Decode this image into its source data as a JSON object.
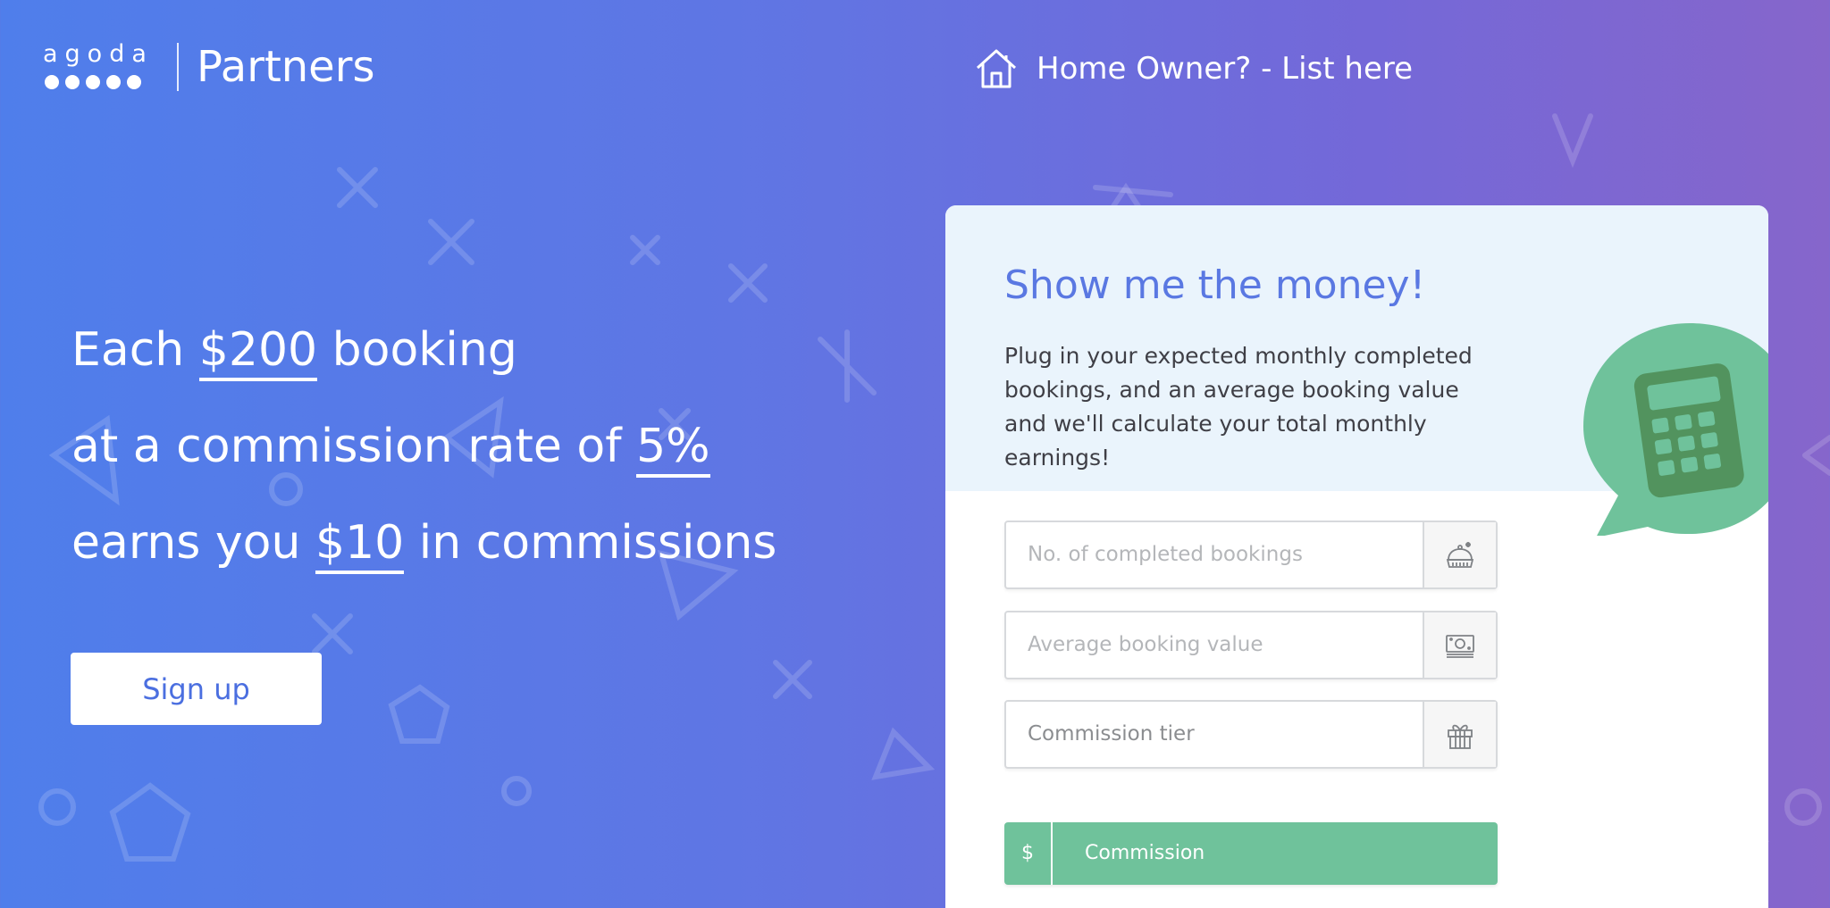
{
  "header": {
    "logo_word": "agoda",
    "logo_partners": "Partners",
    "home_link": "Home Owner? - List here"
  },
  "pitch": {
    "line1_pre": "Each ",
    "line1_value": "$200",
    "line1_post": " booking",
    "line2_pre": "at a commission rate of ",
    "line2_value": "5%",
    "line3_pre": "earns you ",
    "line3_value": "$10",
    "line3_post": " in commissions"
  },
  "signup_label": "Sign up",
  "calculator": {
    "title": "Show me the money!",
    "description": "Plug in your expected monthly completed bookings, and an average booking value and we'll calculate your total monthly earnings!",
    "bookings_placeholder": "No. of completed bookings",
    "booking_value_placeholder": "Average booking value",
    "commission_tier_placeholder": "Commission tier",
    "result_symbol": "$",
    "result_label": "Commission"
  },
  "icons": {
    "home": "home-icon",
    "bookings": "bell-icon",
    "value": "money-icon",
    "tier": "gift-icon",
    "calculator": "calculator-icon"
  },
  "colors": {
    "gradient_start": "#4f7eeb",
    "gradient_end": "#8666cb",
    "title_blue": "#5a78e2",
    "accent_green": "#6fc29b"
  }
}
